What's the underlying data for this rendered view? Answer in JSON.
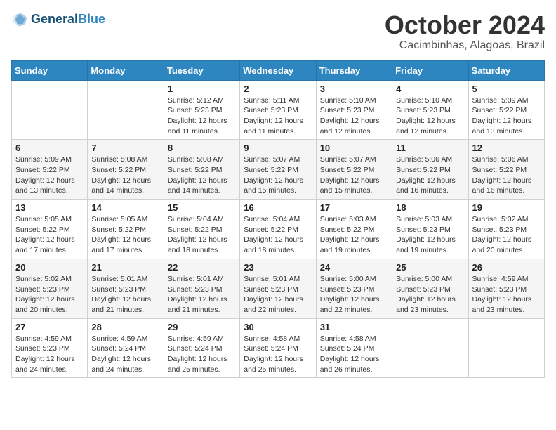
{
  "header": {
    "logo_line1": "General",
    "logo_line2": "Blue",
    "month_title": "October 2024",
    "location": "Cacimbinhas, Alagoas, Brazil"
  },
  "weekdays": [
    "Sunday",
    "Monday",
    "Tuesday",
    "Wednesday",
    "Thursday",
    "Friday",
    "Saturday"
  ],
  "weeks": [
    [
      {
        "day": "",
        "info": ""
      },
      {
        "day": "",
        "info": ""
      },
      {
        "day": "1",
        "info": "Sunrise: 5:12 AM\nSunset: 5:23 PM\nDaylight: 12 hours and 11 minutes."
      },
      {
        "day": "2",
        "info": "Sunrise: 5:11 AM\nSunset: 5:23 PM\nDaylight: 12 hours and 11 minutes."
      },
      {
        "day": "3",
        "info": "Sunrise: 5:10 AM\nSunset: 5:23 PM\nDaylight: 12 hours and 12 minutes."
      },
      {
        "day": "4",
        "info": "Sunrise: 5:10 AM\nSunset: 5:23 PM\nDaylight: 12 hours and 12 minutes."
      },
      {
        "day": "5",
        "info": "Sunrise: 5:09 AM\nSunset: 5:22 PM\nDaylight: 12 hours and 13 minutes."
      }
    ],
    [
      {
        "day": "6",
        "info": "Sunrise: 5:09 AM\nSunset: 5:22 PM\nDaylight: 12 hours and 13 minutes."
      },
      {
        "day": "7",
        "info": "Sunrise: 5:08 AM\nSunset: 5:22 PM\nDaylight: 12 hours and 14 minutes."
      },
      {
        "day": "8",
        "info": "Sunrise: 5:08 AM\nSunset: 5:22 PM\nDaylight: 12 hours and 14 minutes."
      },
      {
        "day": "9",
        "info": "Sunrise: 5:07 AM\nSunset: 5:22 PM\nDaylight: 12 hours and 15 minutes."
      },
      {
        "day": "10",
        "info": "Sunrise: 5:07 AM\nSunset: 5:22 PM\nDaylight: 12 hours and 15 minutes."
      },
      {
        "day": "11",
        "info": "Sunrise: 5:06 AM\nSunset: 5:22 PM\nDaylight: 12 hours and 16 minutes."
      },
      {
        "day": "12",
        "info": "Sunrise: 5:06 AM\nSunset: 5:22 PM\nDaylight: 12 hours and 16 minutes."
      }
    ],
    [
      {
        "day": "13",
        "info": "Sunrise: 5:05 AM\nSunset: 5:22 PM\nDaylight: 12 hours and 17 minutes."
      },
      {
        "day": "14",
        "info": "Sunrise: 5:05 AM\nSunset: 5:22 PM\nDaylight: 12 hours and 17 minutes."
      },
      {
        "day": "15",
        "info": "Sunrise: 5:04 AM\nSunset: 5:22 PM\nDaylight: 12 hours and 18 minutes."
      },
      {
        "day": "16",
        "info": "Sunrise: 5:04 AM\nSunset: 5:22 PM\nDaylight: 12 hours and 18 minutes."
      },
      {
        "day": "17",
        "info": "Sunrise: 5:03 AM\nSunset: 5:22 PM\nDaylight: 12 hours and 19 minutes."
      },
      {
        "day": "18",
        "info": "Sunrise: 5:03 AM\nSunset: 5:23 PM\nDaylight: 12 hours and 19 minutes."
      },
      {
        "day": "19",
        "info": "Sunrise: 5:02 AM\nSunset: 5:23 PM\nDaylight: 12 hours and 20 minutes."
      }
    ],
    [
      {
        "day": "20",
        "info": "Sunrise: 5:02 AM\nSunset: 5:23 PM\nDaylight: 12 hours and 20 minutes."
      },
      {
        "day": "21",
        "info": "Sunrise: 5:01 AM\nSunset: 5:23 PM\nDaylight: 12 hours and 21 minutes."
      },
      {
        "day": "22",
        "info": "Sunrise: 5:01 AM\nSunset: 5:23 PM\nDaylight: 12 hours and 21 minutes."
      },
      {
        "day": "23",
        "info": "Sunrise: 5:01 AM\nSunset: 5:23 PM\nDaylight: 12 hours and 22 minutes."
      },
      {
        "day": "24",
        "info": "Sunrise: 5:00 AM\nSunset: 5:23 PM\nDaylight: 12 hours and 22 minutes."
      },
      {
        "day": "25",
        "info": "Sunrise: 5:00 AM\nSunset: 5:23 PM\nDaylight: 12 hours and 23 minutes."
      },
      {
        "day": "26",
        "info": "Sunrise: 4:59 AM\nSunset: 5:23 PM\nDaylight: 12 hours and 23 minutes."
      }
    ],
    [
      {
        "day": "27",
        "info": "Sunrise: 4:59 AM\nSunset: 5:23 PM\nDaylight: 12 hours and 24 minutes."
      },
      {
        "day": "28",
        "info": "Sunrise: 4:59 AM\nSunset: 5:24 PM\nDaylight: 12 hours and 24 minutes."
      },
      {
        "day": "29",
        "info": "Sunrise: 4:59 AM\nSunset: 5:24 PM\nDaylight: 12 hours and 25 minutes."
      },
      {
        "day": "30",
        "info": "Sunrise: 4:58 AM\nSunset: 5:24 PM\nDaylight: 12 hours and 25 minutes."
      },
      {
        "day": "31",
        "info": "Sunrise: 4:58 AM\nSunset: 5:24 PM\nDaylight: 12 hours and 26 minutes."
      },
      {
        "day": "",
        "info": ""
      },
      {
        "day": "",
        "info": ""
      }
    ]
  ]
}
